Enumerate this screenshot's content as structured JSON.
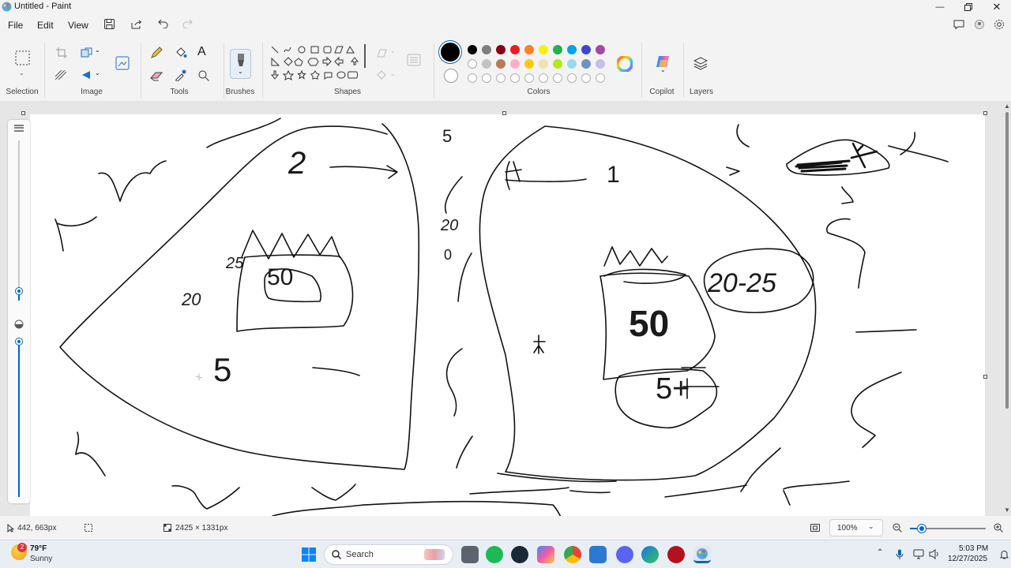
{
  "window": {
    "title": "Untitled - Paint",
    "minimize_icon": "minimize-icon",
    "restore_icon": "restore-icon",
    "close_icon": "close-icon"
  },
  "menu": {
    "file": "File",
    "edit": "Edit",
    "view": "View"
  },
  "ribbon": {
    "groups": {
      "selection": "Selection",
      "image": "Image",
      "tools": "Tools",
      "brushes": "Brushes",
      "shapes": "Shapes",
      "colors": "Colors",
      "copilot": "Copilot",
      "layers": "Layers"
    },
    "colors": {
      "primary": "#000000",
      "secondary": "#ffffff",
      "row1": [
        "#000000",
        "#7f7f7f",
        "#880015",
        "#ed1c24",
        "#ff7f27",
        "#fff200",
        "#22b14c",
        "#00a2e8",
        "#3f48cc",
        "#a349a4"
      ],
      "row2": [
        "#ffffff",
        "#c3c3c3",
        "#b97a57",
        "#ffaec9",
        "#ffc90e",
        "#efe4b0",
        "#b5e61d",
        "#99d9ea",
        "#7092be",
        "#c8bfe7"
      ],
      "row3_empty": 10,
      "accent": "#0067c0"
    }
  },
  "canvas": {
    "texts": {
      "t1": "2",
      "t2": "5",
      "t3": "50",
      "t4": "20",
      "t5": "25",
      "t6": "5",
      "t7": "1",
      "t8": "50",
      "t9": "20-25",
      "t10": "5+",
      "t11": "20",
      "t12": "0"
    }
  },
  "status": {
    "cursor_pos": "442, 663px",
    "canvas_size": "2425 × 1331px",
    "zoom": "100%"
  },
  "taskbar": {
    "weather_temp": "79°F",
    "weather_cond": "Sunny",
    "weather_badge": "2",
    "search_placeholder": "Search",
    "time": "5:03 PM",
    "date": "12/27/2025"
  }
}
